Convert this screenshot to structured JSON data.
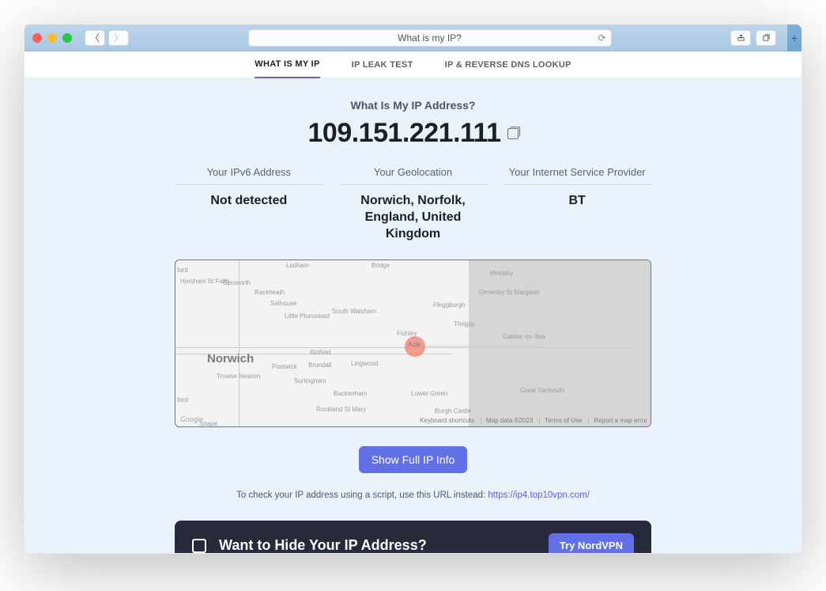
{
  "browser": {
    "title": "What is my IP?"
  },
  "tabs": {
    "t1": "WHAT IS MY IP",
    "t2": "IP LEAK TEST",
    "t3": "IP & REVERSE DNS LOOKUP"
  },
  "header": {
    "label": "What Is My IP Address?",
    "ip": "109.151.221.111"
  },
  "cards": {
    "ipv6": {
      "label": "Your IPv6 Address",
      "value": "Not detected"
    },
    "geo": {
      "label": "Your Geolocation",
      "value": "Norwich, Norfolk, England, United Kingdom"
    },
    "isp": {
      "label": "Your Internet Service Provider",
      "value": "BT"
    }
  },
  "map": {
    "city_label": "Norwich",
    "pin_label": "Acle",
    "towns": {
      "spixworth": "Spixworth",
      "rackheath": "Rackheath",
      "salhouse": "Salhouse",
      "horsham": "Horsham St Faith",
      "plumstead": "Little Plumstead",
      "walsham": "South Walsham",
      "blofield": "Blofield",
      "brundall": "Brundall",
      "postwick": "Postwick",
      "lingwood": "Lingwood",
      "surlingham": "Surlingham",
      "buckenham": "Buckenham",
      "lowergreen": "Lower Green",
      "rockland": "Rockland St Mary",
      "trowse": "Trowse Newton",
      "fishley": "Fishley",
      "hemsby": "Hemsby",
      "ormesby": "Ormesby St Margaret",
      "fleggburgh": "Fleggburgh",
      "thrigby": "Thrigby",
      "caister": "Caister-on-Sea",
      "burgh": "Burgh Castle",
      "yarmouth": "Great Yarmouth",
      "ford": "ford",
      "snape": "Snape",
      "bridge": "Bridge",
      "ludham": "Ludham"
    },
    "attribution": "Google",
    "footer": {
      "kb": "Keyboard shortcuts",
      "md": "Map data ©2023",
      "tu": "Terms of Use",
      "rp": "Report a map error"
    }
  },
  "cta": {
    "show_full": "Show Full IP Info"
  },
  "script_note": {
    "text": "To check your IP address using a script, use this URL instead: ",
    "link": "https://ip4.top10vpn.com/"
  },
  "promo": {
    "title": "Want to Hide Your IP Address?",
    "button": "Try NordVPN"
  }
}
